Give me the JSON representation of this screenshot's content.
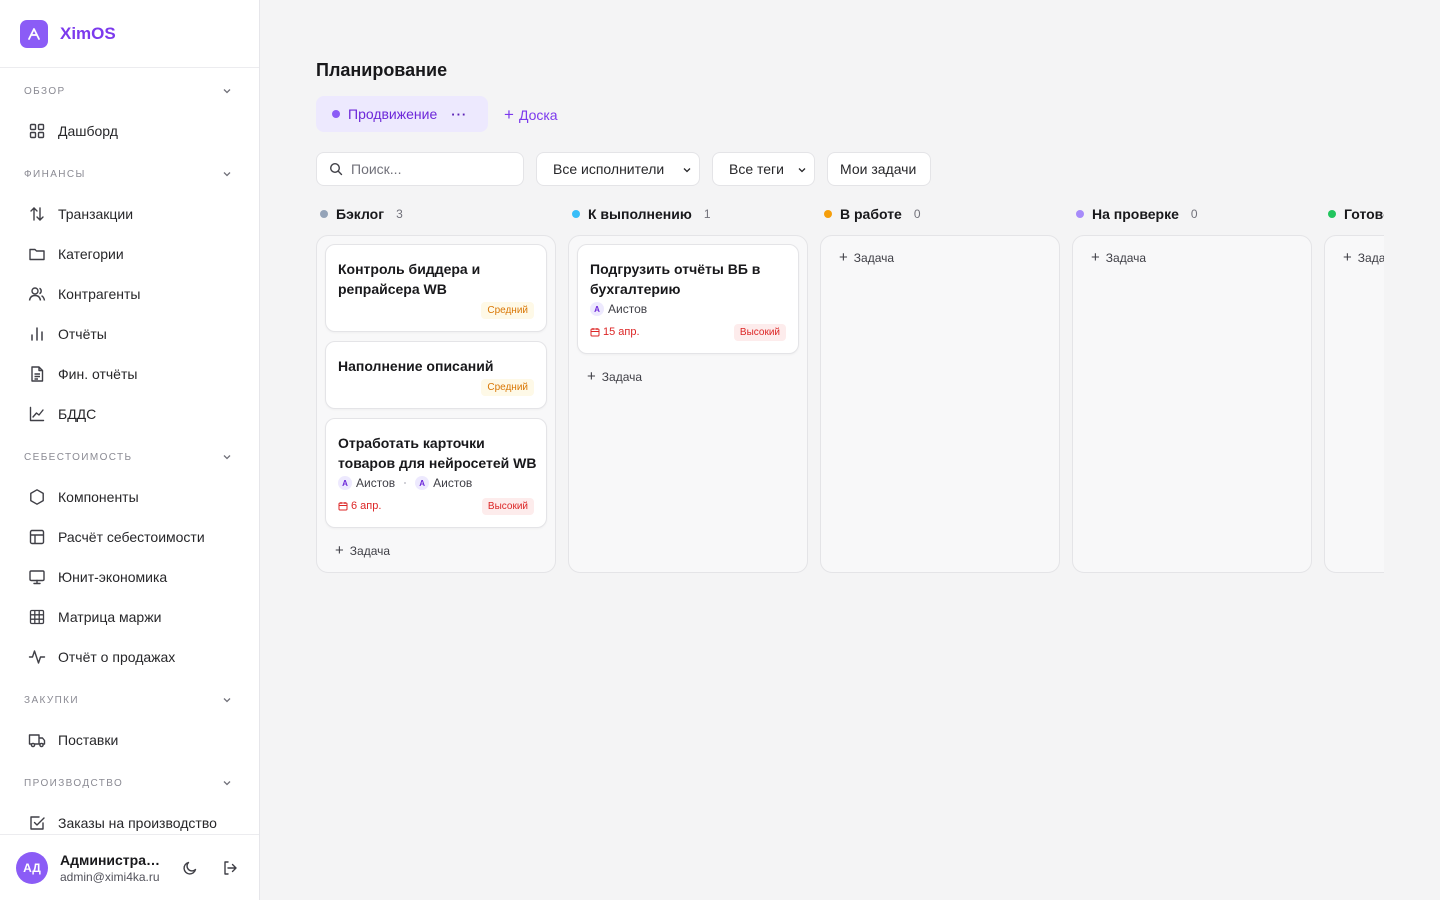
{
  "app": {
    "name": "XimOS"
  },
  "sidebar": {
    "sections": [
      {
        "label": "ОБЗОР",
        "items": [
          {
            "label": "Дашборд",
            "icon": "grid-icon"
          }
        ]
      },
      {
        "label": "ФИНАНСЫ",
        "items": [
          {
            "label": "Транзакции",
            "icon": "arrows-updown-icon"
          },
          {
            "label": "Категории",
            "icon": "folder-icon"
          },
          {
            "label": "Контрагенты",
            "icon": "users-icon"
          },
          {
            "label": "Отчёты",
            "icon": "bar-chart-icon"
          },
          {
            "label": "Фин. отчёты",
            "icon": "file-text-icon"
          },
          {
            "label": "БДДС",
            "icon": "line-chart-icon"
          }
        ]
      },
      {
        "label": "СЕБЕСТОИМОСТЬ",
        "items": [
          {
            "label": "Компоненты",
            "icon": "hexagon-icon"
          },
          {
            "label": "Расчёт себестоимости",
            "icon": "table-icon"
          },
          {
            "label": "Юнит-экономика",
            "icon": "monitor-icon"
          },
          {
            "label": "Матрица маржи",
            "icon": "grid-table-icon"
          },
          {
            "label": "Отчёт о продажах",
            "icon": "activity-icon"
          }
        ]
      },
      {
        "label": "ЗАКУПКИ",
        "items": [
          {
            "label": "Поставки",
            "icon": "truck-icon"
          }
        ]
      },
      {
        "label": "ПРОИЗВОДСТВО",
        "items": [
          {
            "label": "Заказы на производство",
            "icon": "checkbox-icon"
          }
        ]
      }
    ],
    "user": {
      "initials": "АД",
      "name": "Администратор",
      "email": "admin@ximi4ka.ru"
    }
  },
  "page": {
    "title": "Планирование",
    "board_tab": {
      "label": "Продвижение",
      "more": "···",
      "color": "#8b5cf6"
    },
    "add_board": "Доска",
    "filters": {
      "search_placeholder": "Поиск...",
      "assignees": "Все исполнители",
      "tags": "Все теги",
      "my_tasks": "Мои задачи"
    }
  },
  "board": {
    "add_task_label": "Задача",
    "columns": [
      {
        "title": "Бэклог",
        "count": "3",
        "color": "#94a3b8",
        "cards": [
          {
            "title": "Контроль биддера и репрайсера WB",
            "priority": "Средний"
          },
          {
            "title": "Наполнение описаний",
            "priority": "Средний"
          },
          {
            "title": "Отработать карточки товаров для нейросетей WB",
            "assignees": [
              {
                "initial": "А",
                "name": "Аистов"
              },
              {
                "initial": "А",
                "name": "Аистов"
              }
            ],
            "due": "6 апр.",
            "priority": "Высокий"
          }
        ]
      },
      {
        "title": "К выполнению",
        "count": "1",
        "color": "#38bdf8",
        "cards": [
          {
            "title": "Подгрузить отчёты ВБ в бухгалтерию",
            "assignees": [
              {
                "initial": "А",
                "name": "Аистов"
              }
            ],
            "due": "15 апр.",
            "priority": "Высокий"
          }
        ]
      },
      {
        "title": "В работе",
        "count": "0",
        "color": "#f59e0b",
        "cards": []
      },
      {
        "title": "На проверке",
        "count": "0",
        "color": "#a78bfa",
        "cards": []
      },
      {
        "title": "Готово",
        "count": "",
        "color": "#22c55e",
        "cards": []
      }
    ]
  }
}
